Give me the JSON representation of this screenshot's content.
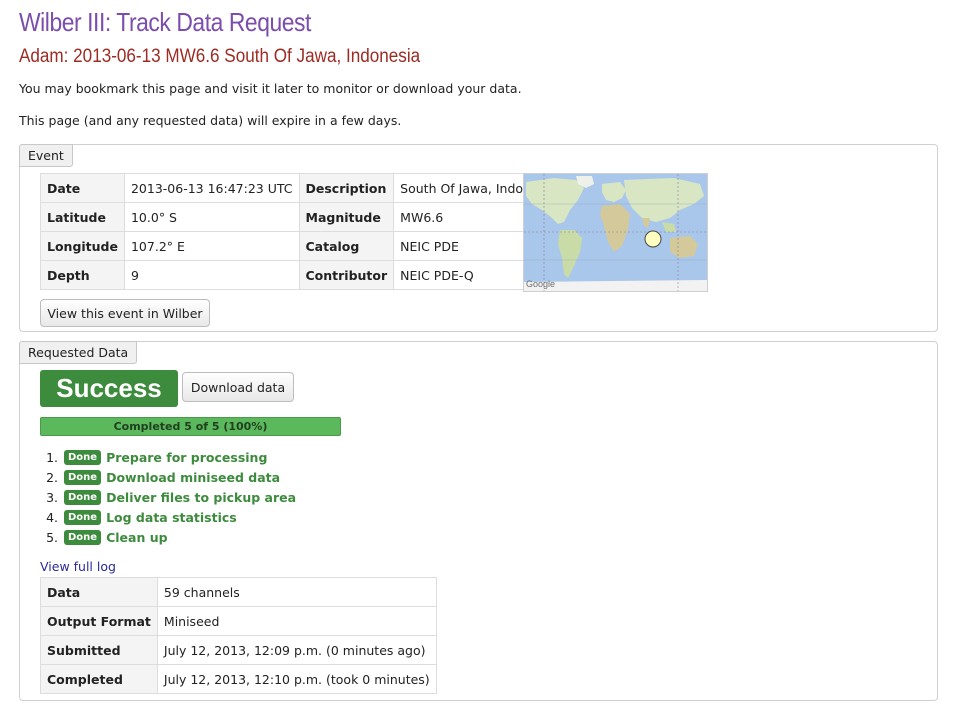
{
  "page": {
    "title": "Wilber III: Track Data Request",
    "subtitle": "Adam: 2013-06-13 MW6.6 South Of Jawa, Indonesia",
    "note1": "You may bookmark this page and visit it later to monitor or download your data.",
    "note2": "This page (and any requested data) will expire in a few days."
  },
  "event": {
    "legend": "Event",
    "rows": [
      {
        "k1": "Date",
        "v1": "2013-06-13 16:47:23 UTC",
        "k2": "Description",
        "v2": "South Of Jawa, Indonesia"
      },
      {
        "k1": "Latitude",
        "v1": "10.0° S",
        "k2": "Magnitude",
        "v2": "MW6.6"
      },
      {
        "k1": "Longitude",
        "v1": "107.2° E",
        "k2": "Catalog",
        "v2": "NEIC PDE"
      },
      {
        "k1": "Depth",
        "v1": "9",
        "k2": "Contributor",
        "v2": "NEIC PDE-Q"
      }
    ],
    "map_label": "Google",
    "view_button": "View this event in Wilber"
  },
  "requested": {
    "legend": "Requested Data",
    "status": "Success",
    "download_button": "Download data",
    "progress_text": "Completed 5 of 5 (100%)",
    "progress_fraction": 1.0,
    "steps": [
      {
        "num": "1.",
        "badge": "Done",
        "label": "Prepare for processing"
      },
      {
        "num": "2.",
        "badge": "Done",
        "label": "Download miniseed data"
      },
      {
        "num": "3.",
        "badge": "Done",
        "label": "Deliver files to pickup area"
      },
      {
        "num": "4.",
        "badge": "Done",
        "label": "Log data statistics"
      },
      {
        "num": "5.",
        "badge": "Done",
        "label": "Clean up"
      }
    ],
    "log_link": "View full log",
    "details": [
      {
        "k": "Data",
        "v": "59 channels"
      },
      {
        "k": "Output Format",
        "v": "Miniseed"
      },
      {
        "k": "Submitted",
        "v": "July 12, 2013, 12:09 p.m. (0 minutes ago)"
      },
      {
        "k": "Completed",
        "v": "July 12, 2013, 12:10 p.m. (took 0 minutes)"
      }
    ]
  },
  "colors": {
    "title": "#7b4dad",
    "subtitle": "#9c2b23",
    "success": "#3d8b3d",
    "progress": "#5cb85c"
  }
}
